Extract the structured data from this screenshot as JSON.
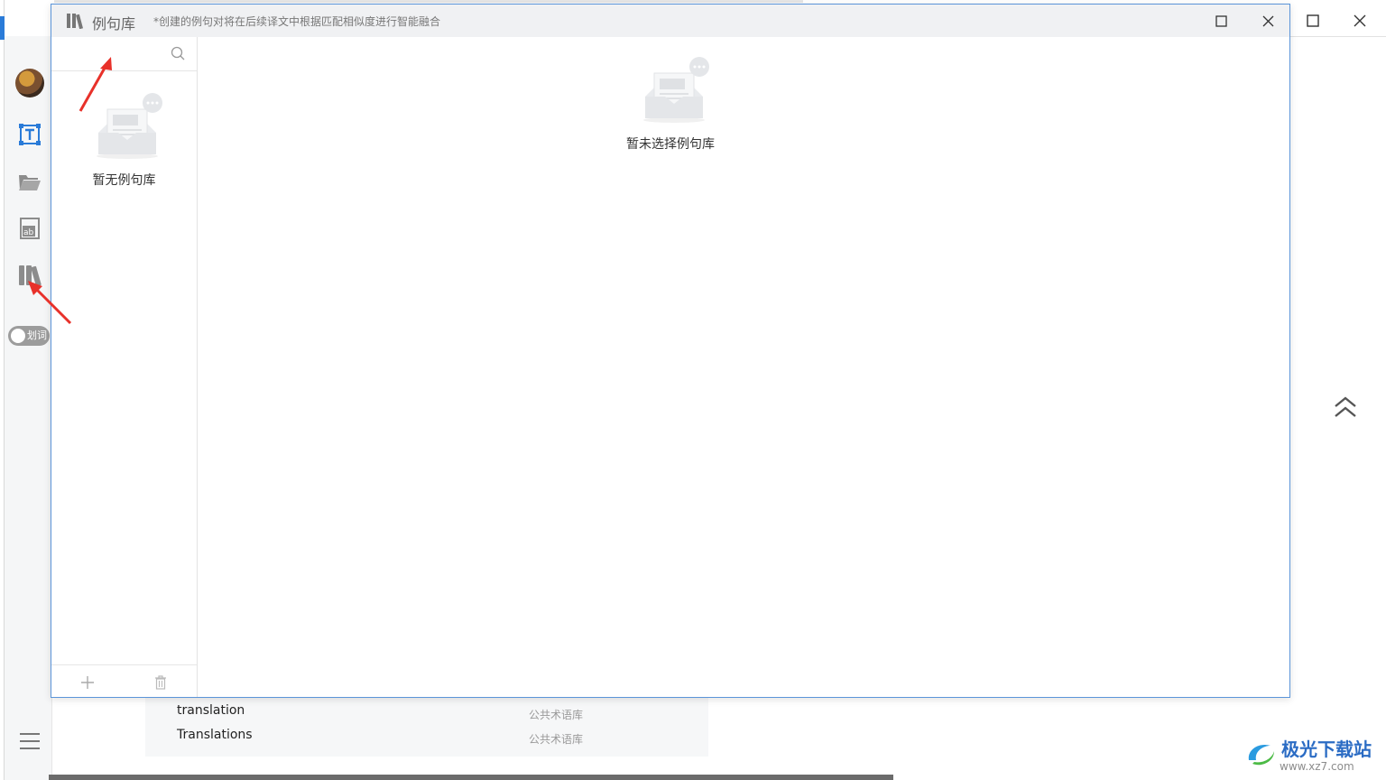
{
  "background_window": {
    "list_rows": [
      {
        "term": "translation",
        "source": "公共术语库"
      },
      {
        "term": "Translations",
        "source": "公共术语库"
      }
    ]
  },
  "sidebar": {
    "toggle_label": "划词"
  },
  "dialog": {
    "title": "例句库",
    "hint": "*创建的例句对将在后续译文中根据匹配相似度进行智能融合",
    "search": {
      "value": "",
      "placeholder": ""
    },
    "left_empty_text": "暂无例句库",
    "right_empty_text": "暂未选择例句库"
  },
  "watermark": {
    "name": "极光下载站",
    "url": "www.xz7.com"
  },
  "colors": {
    "accent": "#2a7bd8",
    "dialog_border": "#5b95d9",
    "arrow_red": "#e8312a",
    "title_bar": "#f0f1f3"
  }
}
